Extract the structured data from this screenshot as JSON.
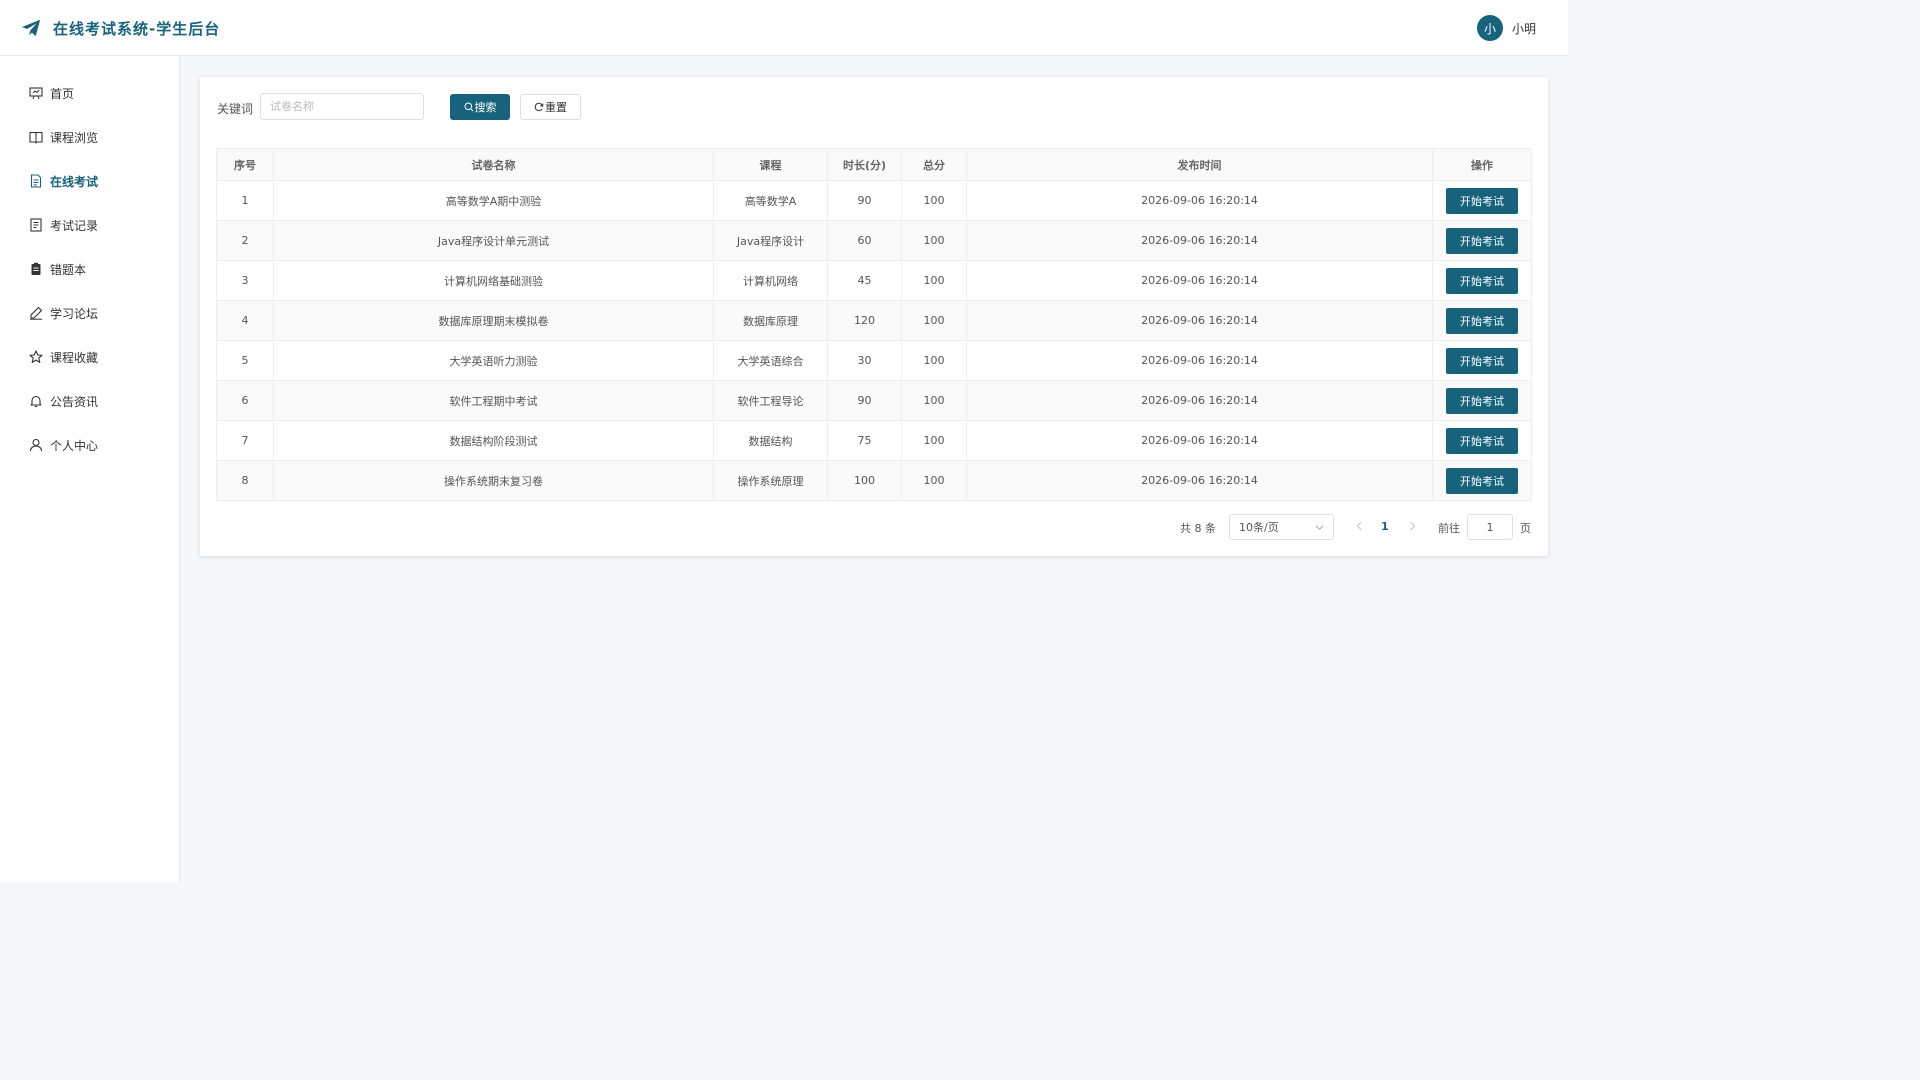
{
  "header": {
    "app_title": "在线考试系统-学生后台",
    "user": {
      "avatar_text": "小",
      "name": "小明"
    }
  },
  "sidebar": {
    "items": [
      {
        "label": "首页",
        "icon": "presentation-icon",
        "active": false
      },
      {
        "label": "课程浏览",
        "icon": "book-open-icon",
        "active": false
      },
      {
        "label": "在线考试",
        "icon": "document-icon",
        "active": true
      },
      {
        "label": "考试记录",
        "icon": "record-icon",
        "active": false
      },
      {
        "label": "错题本",
        "icon": "notebook-icon",
        "active": false
      },
      {
        "label": "学习论坛",
        "icon": "pen-icon",
        "active": false
      },
      {
        "label": "课程收藏",
        "icon": "star-icon",
        "active": false
      },
      {
        "label": "公告资讯",
        "icon": "bell-icon",
        "active": false
      },
      {
        "label": "个人中心",
        "icon": "user-icon",
        "active": false
      }
    ]
  },
  "search": {
    "keyword_label": "关键词",
    "placeholder": "试卷名称",
    "value": "",
    "search_button": "搜索",
    "reset_button": "重置"
  },
  "table": {
    "headers": [
      "序号",
      "试卷名称",
      "课程",
      "时长(分)",
      "总分",
      "发布时间",
      "操作"
    ],
    "rows": [
      {
        "index": "1",
        "name": "高等数学A期中测验",
        "course": "高等数学A",
        "duration": "90",
        "score": "100",
        "published": "2026-09-06 16:20:14",
        "action": "开始考试"
      },
      {
        "index": "2",
        "name": "Java程序设计单元测试",
        "course": "Java程序设计",
        "duration": "60",
        "score": "100",
        "published": "2026-09-06 16:20:14",
        "action": "开始考试"
      },
      {
        "index": "3",
        "name": "计算机网络基础测验",
        "course": "计算机网络",
        "duration": "45",
        "score": "100",
        "published": "2026-09-06 16:20:14",
        "action": "开始考试"
      },
      {
        "index": "4",
        "name": "数据库原理期末模拟卷",
        "course": "数据库原理",
        "duration": "120",
        "score": "100",
        "published": "2026-09-06 16:20:14",
        "action": "开始考试"
      },
      {
        "index": "5",
        "name": "大学英语听力测验",
        "course": "大学英语综合",
        "duration": "30",
        "score": "100",
        "published": "2026-09-06 16:20:14",
        "action": "开始考试"
      },
      {
        "index": "6",
        "name": "软件工程期中考试",
        "course": "软件工程导论",
        "duration": "90",
        "score": "100",
        "published": "2026-09-06 16:20:14",
        "action": "开始考试"
      },
      {
        "index": "7",
        "name": "数据结构阶段测试",
        "course": "数据结构",
        "duration": "75",
        "score": "100",
        "published": "2026-09-06 16:20:14",
        "action": "开始考试"
      },
      {
        "index": "8",
        "name": "操作系统期末复习卷",
        "course": "操作系统原理",
        "duration": "100",
        "score": "100",
        "published": "2026-09-06 16:20:14",
        "action": "开始考试"
      }
    ]
  },
  "pagination": {
    "total_text": "共 8 条",
    "page_size": "10条/页",
    "current_page": "1",
    "goto_label": "前往",
    "goto_value": "1",
    "page_suffix": "页"
  },
  "colors": {
    "primary": "#17637c",
    "background": "#f5f7fa"
  }
}
